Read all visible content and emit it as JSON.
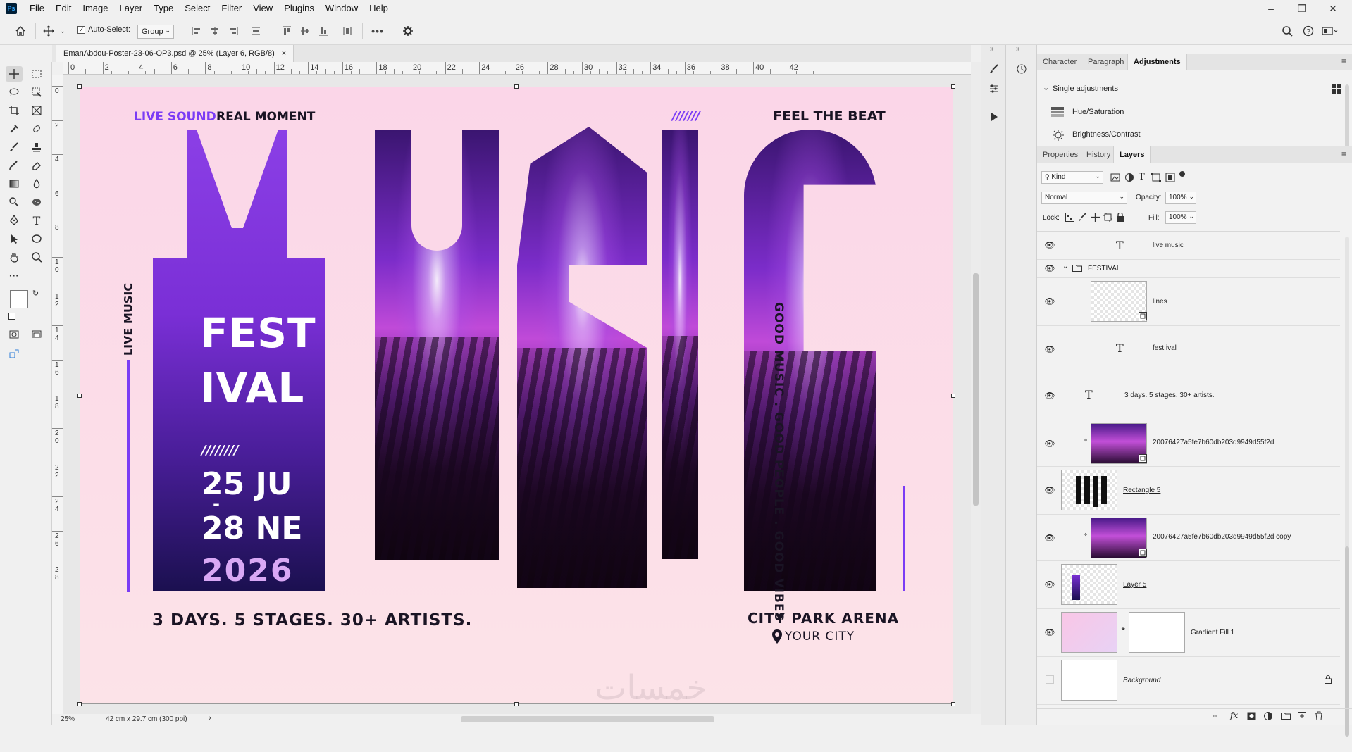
{
  "app": {
    "logo": "Ps"
  },
  "menu": [
    "File",
    "Edit",
    "Image",
    "Layer",
    "Type",
    "Select",
    "Filter",
    "View",
    "Plugins",
    "Window",
    "Help"
  ],
  "options": {
    "auto_select_label": "Auto-Select:",
    "auto_select_checked": true,
    "group_value": "Group",
    "more_label": "•••"
  },
  "document": {
    "tab_title": "EmanAbdou-Poster-23-06-OP3.psd @ 25% (Layer 6, RGB/8)",
    "close_glyph": "×"
  },
  "rulers": {
    "h_labels": [
      "0",
      "2",
      "4",
      "6",
      "8",
      "10",
      "12",
      "14",
      "16",
      "18",
      "20",
      "22",
      "24",
      "26",
      "28",
      "30",
      "32",
      "34",
      "36",
      "38",
      "40",
      "42"
    ],
    "v_labels": [
      "0",
      "2",
      "4",
      "6",
      "8",
      "10",
      "12",
      "14",
      "16",
      "18",
      "20",
      "22",
      "24",
      "26",
      "28"
    ]
  },
  "status": {
    "zoom": "25%",
    "doc_info": "42 cm x 29.7 cm (300 ppi)",
    "arrow": "›"
  },
  "poster": {
    "tagline_left_a": "LIVE SOUND.",
    "tagline_left_b": "REAL MOMENT",
    "tagline_right_slashes": "///////",
    "tagline_right": "FEEL THE BEAT",
    "vertical_left": "LIVE MUSIC",
    "vertical_right": "GOOD MUSIC . GOOD PEOPLE . GOOD VIBES",
    "fest": "FEST",
    "ival": "IVAL",
    "slashes": "////////",
    "date_line1": "25 JU",
    "date_dash": "-",
    "date_line2": "28 NE",
    "year": "2026",
    "bottom_left": "3 DAYS. 5 STAGES. 30+ ARTISTS.",
    "venue": "CITY PARK ARENA",
    "city": "YOUR CITY",
    "watermark": "خمسات",
    "colors": {
      "accent": "#7b3cf5",
      "dark": "#1a1424",
      "bg_top": "#fbd6e8",
      "bg_bottom": "#fce3e8"
    }
  },
  "top_panel": {
    "tabs": [
      "Character",
      "Paragraph",
      "Adjustments"
    ],
    "active_tab": "Adjustments",
    "section": "Single adjustments",
    "items": [
      "Hue/Saturation",
      "Brightness/Contrast"
    ]
  },
  "layers_panel": {
    "tabs": [
      "Properties",
      "History",
      "Layers"
    ],
    "active_tab": "Layers",
    "filter_kind": "Kind",
    "blend_mode": "Normal",
    "opacity_label": "Opacity:",
    "opacity_value": "100%",
    "lock_label": "Lock:",
    "fill_label": "Fill:",
    "fill_value": "100%",
    "layers": [
      {
        "name": "live music",
        "type": "text"
      },
      {
        "name": "FESTIVAL",
        "type": "group"
      },
      {
        "name": "lines",
        "type": "smart"
      },
      {
        "name": "fest ival",
        "type": "text"
      },
      {
        "name": "3 days. 5 stages. 30+ artists.",
        "type": "text"
      },
      {
        "name": "20076427a5fe7b60db203d9949d55f2d",
        "type": "photo"
      },
      {
        "name": "Rectangle 5",
        "type": "shape"
      },
      {
        "name": "20076427a5fe7b60db203d9949d55f2d  copy",
        "type": "photo"
      },
      {
        "name": "Layer 5",
        "type": "raster"
      },
      {
        "name": "Gradient Fill 1",
        "type": "fill"
      },
      {
        "name": "Background",
        "type": "background"
      }
    ]
  }
}
